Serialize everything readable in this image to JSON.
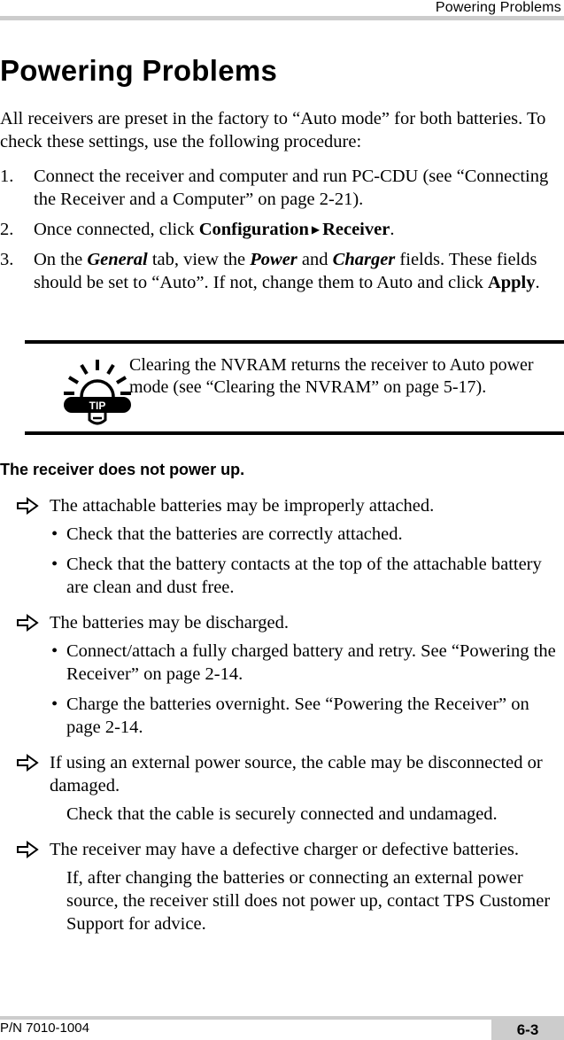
{
  "header": {
    "running_title": "Powering Problems"
  },
  "page_title": "Powering Problems",
  "intro": "All receivers are preset in the factory to “Auto mode” for both batteries. To check these settings, use the following procedure:",
  "steps": [
    {
      "number": "1.",
      "text": "Connect the receiver and computer and run PC-CDU (see “Connecting the Receiver and a Computer” on page 2-21)."
    },
    {
      "number": "2.",
      "prefix": "Once connected, click ",
      "menu_1": "Configuration",
      "menu_separator": "▶",
      "menu_2": "Receiver",
      "suffix": "."
    },
    {
      "number": "3.",
      "p1": "On the ",
      "tab": "General",
      "p2": " tab, view the ",
      "field_1": "Power",
      "p3": " and ",
      "field_2": "Charger",
      "p4": " fields. These fields should be set to “Auto”. If not, change them to Auto and click ",
      "button": "Apply",
      "p5": "."
    }
  ],
  "tip": {
    "icon": "tip-lightbulb-icon",
    "icon_label": "TIP",
    "text": "Clearing the NVRAM returns the receiver to Auto power mode (see “Clearing the NVRAM” on page 5-17)."
  },
  "section_heading": "The receiver does not power up.",
  "problems": [
    {
      "cause": "The attachable batteries may be improperly attached.",
      "bullets": [
        "Check that the batteries are correctly attached.",
        "Check that the battery contacts at the top of the attachable battery are clean and dust free."
      ]
    },
    {
      "cause": "The batteries may be discharged.",
      "bullets": [
        "Connect/attach a fully charged battery and retry. See “Powering the Receiver” on page 2-14.",
        "Charge the batteries overnight. See “Powering the Receiver” on page 2-14."
      ]
    },
    {
      "cause": "If using an external power source, the cable may be disconnected or damaged.",
      "remedy": "Check that the cable is securely connected and undamaged."
    },
    {
      "cause": "The receiver may have a defective charger or defective batteries.",
      "remedy": "If, after changing the batteries or connecting an external power source, the receiver still does not power up, contact TPS Customer Support for advice."
    }
  ],
  "bullet_glyph": "•",
  "footer": {
    "part_number": "P/N 7010-1004",
    "page_number": "6-3"
  }
}
